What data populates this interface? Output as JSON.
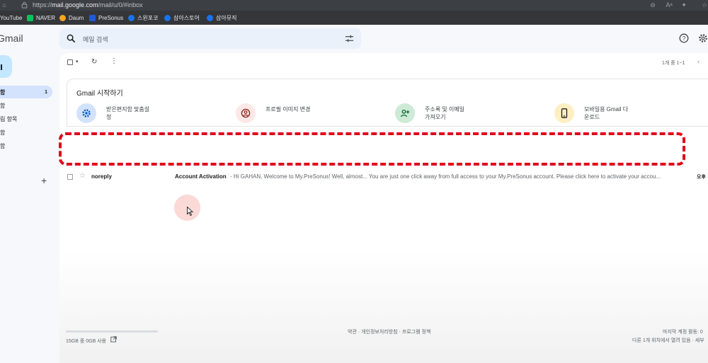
{
  "browser": {
    "url_prefix": "https://",
    "url_host": "mail.google.com",
    "url_path": "/mail/u/0/#inbox"
  },
  "bookmarks": [
    {
      "label": "YouTube",
      "icon": "youtube-icon",
      "color": "#ff0000"
    },
    {
      "label": "NAVER",
      "icon": "naver-icon",
      "color": "#03c75a"
    },
    {
      "label": "Daum",
      "icon": "daum-icon",
      "color": "#f5a623"
    },
    {
      "label": "PreSonus",
      "icon": "presonus-icon",
      "color": "#1e5bd6"
    },
    {
      "label": "스윈포코",
      "icon": "globe-icon",
      "color": "#1a73e8"
    },
    {
      "label": "삼아스토어",
      "icon": "globe-icon",
      "color": "#1a73e8"
    },
    {
      "label": "삼아뮤직",
      "icon": "globe-icon",
      "color": "#1a73e8"
    }
  ],
  "gmail": {
    "logo": "Gmail",
    "search_placeholder": "메일 검색",
    "sidebar": [
      {
        "label": "함",
        "count": "1",
        "active": true
      },
      {
        "label": "함",
        "count": "",
        "active": false
      },
      {
        "label": "림 항목",
        "count": "",
        "active": false
      },
      {
        "label": "함",
        "count": "",
        "active": false
      },
      {
        "label": "함",
        "count": "",
        "active": false
      }
    ],
    "sidebar_add": "+",
    "pagination": "1개 중 1~1",
    "getting_started": {
      "title": "Gmail 시작하기",
      "tiles": [
        {
          "label": "받은편지함 맞춤설\n정",
          "icon": "gear-icon",
          "bg": "#d3e3fd"
        },
        {
          "label": "프로필 이미지 변경",
          "icon": "profile-icon",
          "bg": "#fce8e6"
        },
        {
          "label": "주소록 및 이메일\n가져오기",
          "icon": "add-contact-icon",
          "bg": "#ceead6"
        },
        {
          "label": "모바일용 Gmail 다\n운로드",
          "icon": "mobile-icon",
          "bg": "#feefc3"
        }
      ]
    },
    "email": {
      "sender": "noreply",
      "subject": "Account Activation",
      "snippet": "- Hi GAHAN, Welcome to My.PreSonus! Well, almost... You are just one click away from full access to your My.PreSonus account. Please click here to activate your accou...",
      "time": "오후"
    },
    "footer": {
      "storage": "15GB 중 0GB 사용",
      "storage_used_fraction": 0,
      "links": "약관 · 개인정보처리방침 · 프로그램 정책",
      "activity_line1": "마지막 계정 활동: 0",
      "activity_line2": "다른 1개 위치에서 열려 있음 · 세부"
    }
  },
  "accent_colors": {
    "highlight_box": "#e0001b",
    "active_nav": "#d3e3fd"
  }
}
